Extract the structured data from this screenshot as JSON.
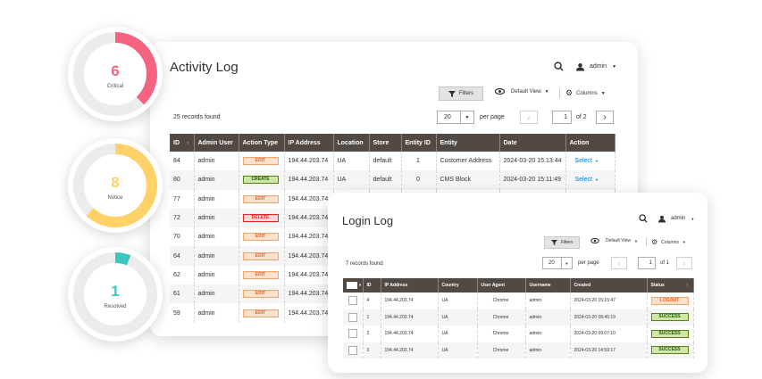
{
  "gauges": [
    {
      "value": "6",
      "label": "Critical",
      "fraction": 0.38,
      "color": "#f4637f"
    },
    {
      "value": "8",
      "label": "Notice",
      "fraction": 0.62,
      "color": "#ffd166"
    },
    {
      "value": "1",
      "label": "Resolved",
      "fraction": 0.06,
      "color": "#3cc6c0"
    }
  ],
  "activity": {
    "title": "Activity Log",
    "user": "admin",
    "filters_label": "Filters",
    "view_label": "Default View",
    "columns_label": "Columns",
    "records": "25 records found",
    "per_page_value": "20",
    "per_page_label": "per page",
    "page_value": "1",
    "page_of": "of 2",
    "headers": [
      "ID",
      "Admin User",
      "Action Type",
      "IP Address",
      "Location",
      "Store",
      "Entity ID",
      "Entity",
      "Date",
      "Action"
    ],
    "rows": [
      {
        "id": "84",
        "user": "admin",
        "type": "EDIT",
        "ip": "194.44.203.74",
        "loc": "UA",
        "store": "default",
        "eid": "1",
        "entity": "Customer Address",
        "date": "2024-03-20 15:13:44",
        "action": "Select"
      },
      {
        "id": "80",
        "user": "admin",
        "type": "CREATE",
        "ip": "194.44.203.74",
        "loc": "UA",
        "store": "default",
        "eid": "0",
        "entity": "CMS Block",
        "date": "2024-03-20 15:11:49",
        "action": "Select"
      },
      {
        "id": "77",
        "user": "admin",
        "type": "EDIT",
        "ip": "194.44.203.74",
        "loc": "",
        "store": "",
        "eid": "",
        "entity": "",
        "date": "",
        "action": ""
      },
      {
        "id": "72",
        "user": "admin",
        "type": "DELETE",
        "ip": "194.44.203.74",
        "loc": "",
        "store": "",
        "eid": "",
        "entity": "",
        "date": "",
        "action": ""
      },
      {
        "id": "70",
        "user": "admin",
        "type": "EDIT",
        "ip": "194.44.203.74",
        "loc": "",
        "store": "",
        "eid": "",
        "entity": "",
        "date": "",
        "action": ""
      },
      {
        "id": "64",
        "user": "admin",
        "type": "EDIT",
        "ip": "194.44.203.74",
        "loc": "",
        "store": "",
        "eid": "",
        "entity": "",
        "date": "",
        "action": ""
      },
      {
        "id": "62",
        "user": "admin",
        "type": "EDIT",
        "ip": "194.44.203.74",
        "loc": "",
        "store": "",
        "eid": "",
        "entity": "",
        "date": "",
        "action": ""
      },
      {
        "id": "61",
        "user": "admin",
        "type": "EDIT",
        "ip": "194.44.203.74",
        "loc": "",
        "store": "",
        "eid": "",
        "entity": "",
        "date": "",
        "action": ""
      },
      {
        "id": "59",
        "user": "admin",
        "type": "EDIT",
        "ip": "194.44.203.74",
        "loc": "",
        "store": "",
        "eid": "",
        "entity": "",
        "date": "",
        "action": ""
      }
    ]
  },
  "login": {
    "title": "Login Log",
    "user": "admin",
    "filters_label": "Filters",
    "view_label": "Default View",
    "columns_label": "Columns",
    "records": "7 records found",
    "per_page_value": "20",
    "per_page_label": "per page",
    "page_value": "1",
    "page_of": "of 1",
    "headers": [
      "",
      "ID",
      "IP Address",
      "Country",
      "User Agent",
      "Username",
      "Created",
      "Status"
    ],
    "rows": [
      {
        "id": "4",
        "ip": "194.44.203.74",
        "country": "UA",
        "agent": "Chrome",
        "user": "admin",
        "created": "2024-03-20 15:15:47",
        "status": "LOGOUT"
      },
      {
        "id": "1",
        "ip": "194.44.203.74",
        "country": "UA",
        "agent": "Chrome",
        "user": "admin",
        "created": "2024-03-20 08:45:19",
        "status": "SUCCESS"
      },
      {
        "id": "2",
        "ip": "194.44.203.74",
        "country": "UA",
        "agent": "Chrome",
        "user": "admin",
        "created": "2024-03-20 09:07:10",
        "status": "SUCCESS"
      },
      {
        "id": "3",
        "ip": "194.44.203.74",
        "country": "UA",
        "agent": "Chrome",
        "user": "admin",
        "created": "2024-03-20 14:59:17",
        "status": "SUCCESS"
      }
    ]
  }
}
